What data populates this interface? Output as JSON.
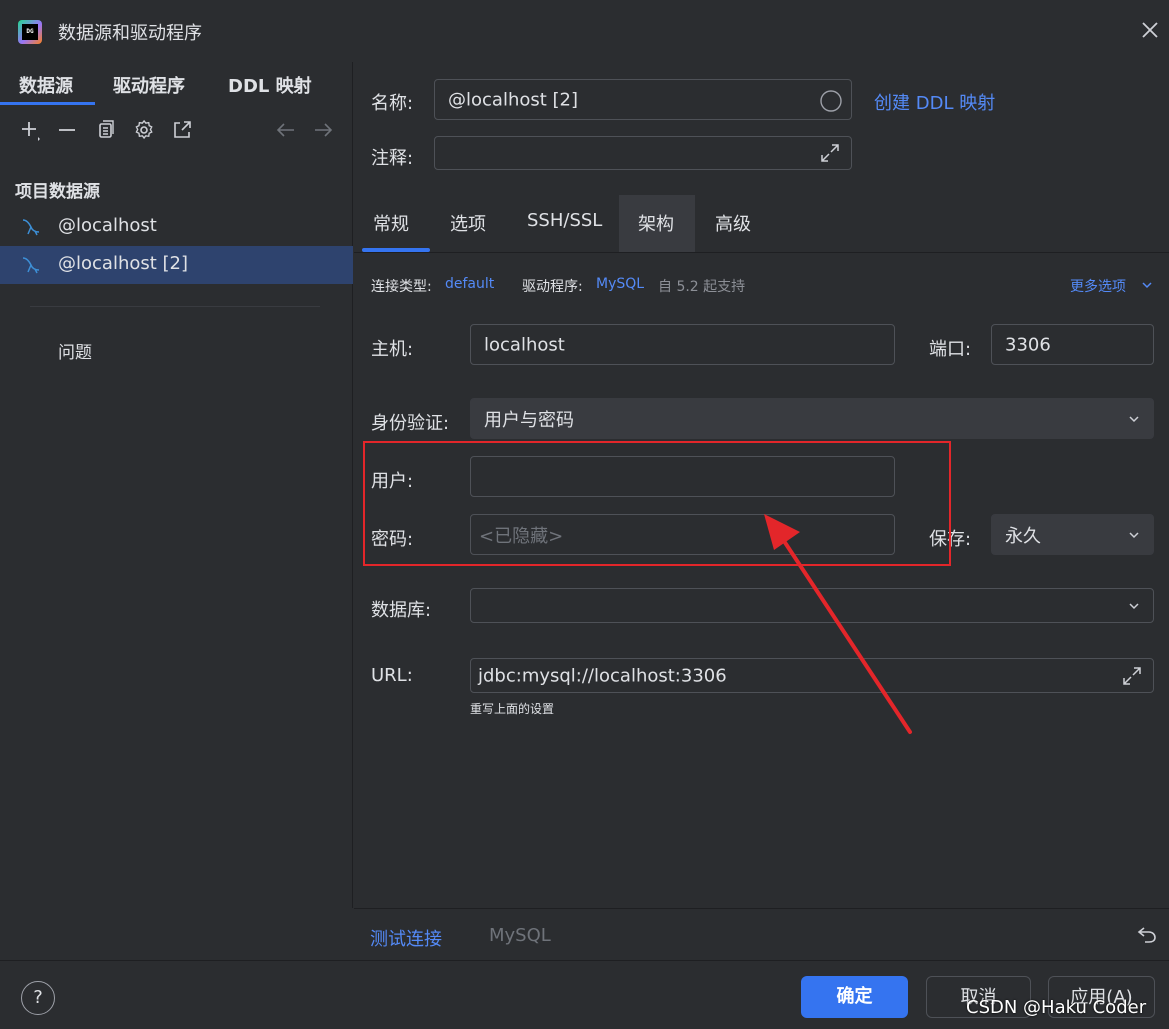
{
  "window": {
    "title": "数据源和驱动程序",
    "app_icon_text": "DG"
  },
  "left_tabs": [
    {
      "label": "数据源"
    },
    {
      "label": "驱动程序"
    },
    {
      "label": "DDL 映射"
    }
  ],
  "toolbar_icons": [
    "add-icon",
    "remove-icon",
    "duplicate-icon",
    "settings-icon",
    "open-external-icon",
    "back-arrow-icon",
    "forward-arrow-icon"
  ],
  "tree": {
    "section_title": "项目数据源",
    "items": [
      {
        "label": "@localhost",
        "selected": false
      },
      {
        "label": "@localhost [2]",
        "selected": true
      }
    ],
    "problems_label": "问题"
  },
  "header": {
    "name_label": "名称:",
    "name_value": "@localhost [2]",
    "create_ddl_link": "创建 DDL 映射",
    "comment_label": "注释:",
    "comment_value": ""
  },
  "right_tabs": [
    {
      "label": "常规",
      "active": true
    },
    {
      "label": "选项",
      "active": false
    },
    {
      "label": "SSH/SSL",
      "active": false
    },
    {
      "label": "架构",
      "active": false
    },
    {
      "label": "高级",
      "active": false
    }
  ],
  "meta": {
    "conn_type_label": "连接类型:",
    "conn_type_value": "default",
    "driver_label": "驱动程序:",
    "driver_value": "MySQL",
    "driver_note": "自 5.2 起支持",
    "more_options": "更多选项"
  },
  "form": {
    "host_label": "主机:",
    "host_value": "localhost",
    "port_label": "端口:",
    "port_value": "3306",
    "auth_label": "身份验证:",
    "auth_value": "用户与密码",
    "user_label": "用户:",
    "user_value": "",
    "password_label": "密码:",
    "password_placeholder": "<已隐藏>",
    "save_label": "保存:",
    "save_value": "永久",
    "database_label": "数据库:",
    "database_value": "",
    "url_label": "URL:",
    "url_value": "jdbc:mysql://localhost:3306",
    "url_hint": "重写上面的设置"
  },
  "bottom": {
    "test_connection": "测试连接",
    "driver_name": "MySQL"
  },
  "footer": {
    "help": "?",
    "ok": "确定",
    "cancel": "取消",
    "apply": "应用(A)"
  },
  "watermark": "CSDN @Haku Coder",
  "colors": {
    "background": "#2b2d30",
    "accent": "#3574f0",
    "link": "#548af7",
    "selection": "#2e436e",
    "annotation_red": "#e3262a"
  }
}
